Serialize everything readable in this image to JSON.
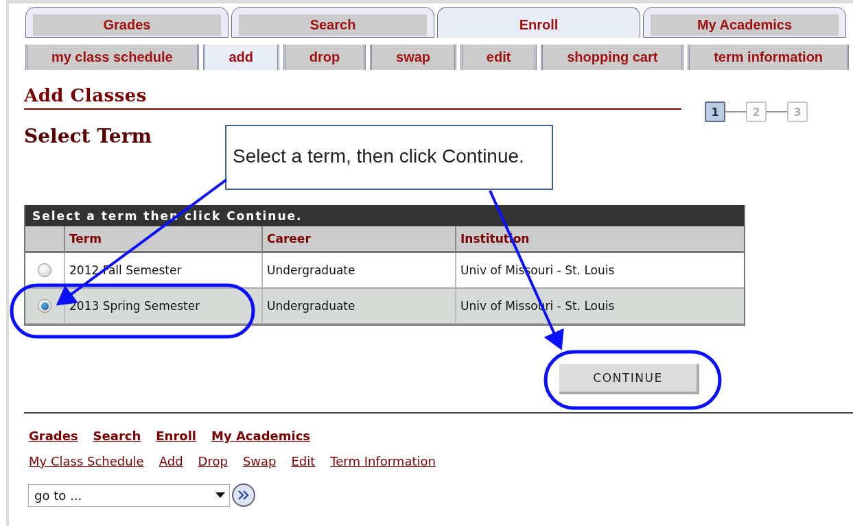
{
  "tabs": [
    {
      "label": "Grades",
      "selected": false
    },
    {
      "label": "Search",
      "selected": false
    },
    {
      "label": "Enroll",
      "selected": true
    },
    {
      "label": "My Academics",
      "selected": false
    }
  ],
  "subtabs": [
    {
      "label": "my class schedule",
      "selected": false
    },
    {
      "label": "add",
      "selected": true
    },
    {
      "label": "drop",
      "selected": false
    },
    {
      "label": "swap",
      "selected": false
    },
    {
      "label": "edit",
      "selected": false
    },
    {
      "label": "shopping cart",
      "selected": false
    },
    {
      "label": "term information",
      "selected": false
    }
  ],
  "page_title": "Add Classes",
  "steps": [
    {
      "label": "1",
      "selected": true
    },
    {
      "label": "2",
      "selected": false
    },
    {
      "label": "3",
      "selected": false
    }
  ],
  "section_title": "Select Term",
  "callout": {
    "text": "Select a term, then click Continue."
  },
  "term_table": {
    "title": "Select a term then click Continue.",
    "columns": [
      "Term",
      "Career",
      "Institution"
    ],
    "rows": [
      {
        "selected": false,
        "term": "2012 Fall Semester",
        "career": "Undergraduate",
        "institution": "Univ of Missouri - St. Louis"
      },
      {
        "selected": true,
        "term": "2013 Spring Semester",
        "career": "Undergraduate",
        "institution": "Univ of Missouri - St. Louis"
      }
    ]
  },
  "continue_button": "CONTINUE",
  "footer_links": {
    "main": [
      "Grades",
      "Search",
      "Enroll",
      "My Academics"
    ],
    "sub": [
      "My Class Schedule",
      "Add",
      "Drop",
      "Swap",
      "Edit",
      "Term Information"
    ]
  },
  "goto": {
    "value": "go to ..."
  }
}
